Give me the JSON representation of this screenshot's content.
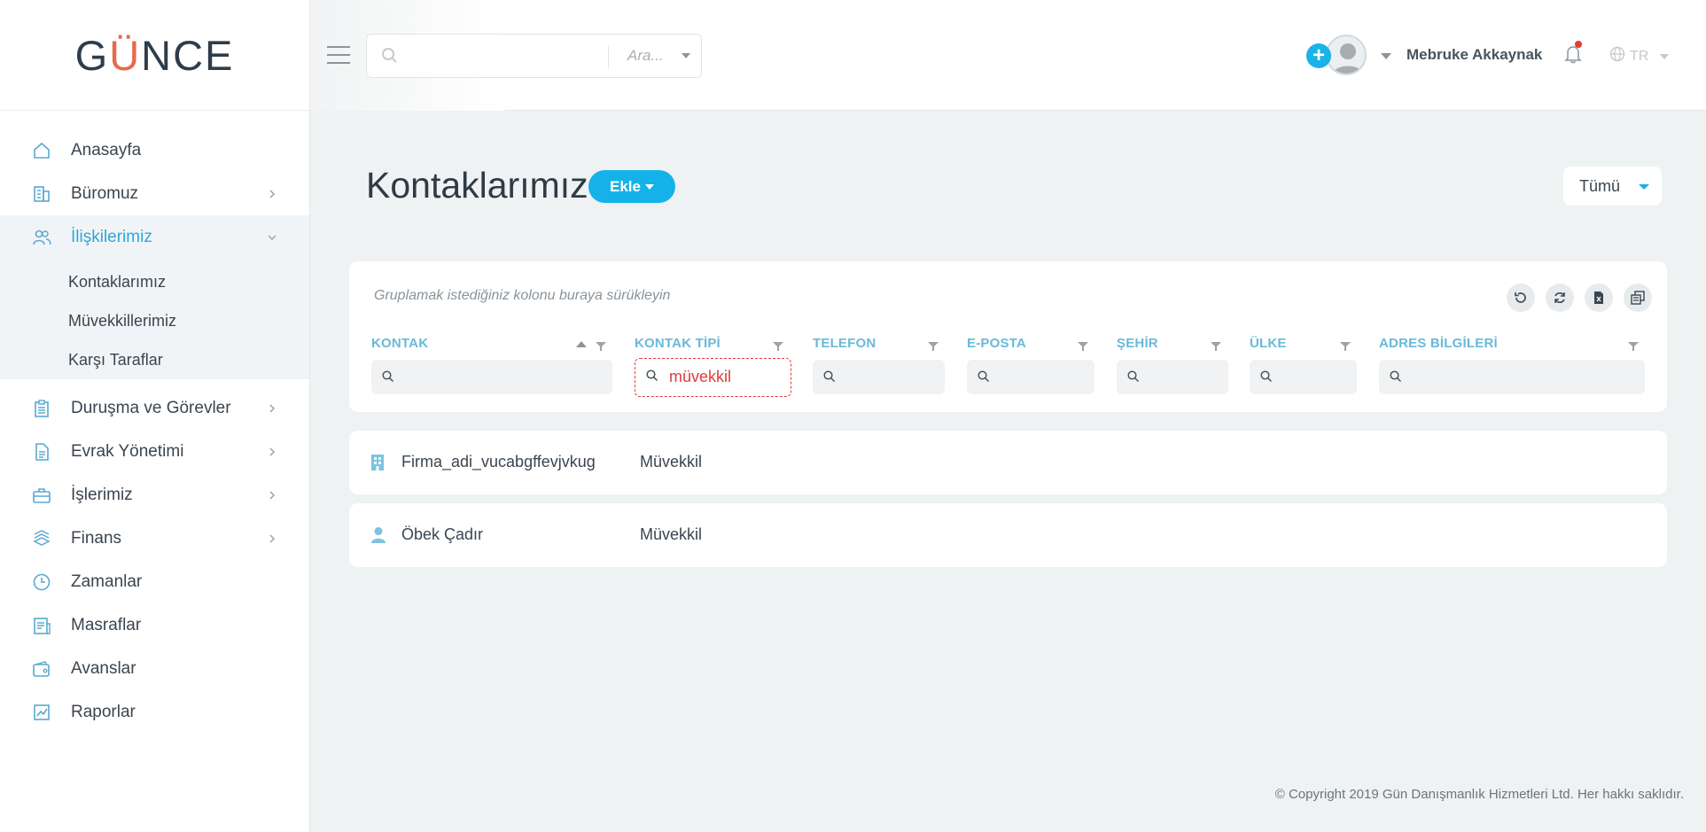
{
  "brand": {
    "logo_prefix": "G",
    "logo_o": "Ü",
    "logo_suffix": "NCE"
  },
  "sidebar": {
    "items": [
      {
        "label": "Anasayfa",
        "icon": "home-icon"
      },
      {
        "label": "Büromuz",
        "icon": "building-icon",
        "has_children": true
      },
      {
        "label": "İlişkilerimiz",
        "icon": "users-icon",
        "has_children": true,
        "expanded": true,
        "children": [
          "Kontaklarımız",
          "Müvekkillerimiz",
          "Karşı Taraflar"
        ]
      },
      {
        "label": "Duruşma ve Görevler",
        "icon": "clipboard-icon",
        "has_children": true
      },
      {
        "label": "Evrak Yönetimi",
        "icon": "document-icon",
        "has_children": true
      },
      {
        "label": "İşlerimiz",
        "icon": "briefcase-icon",
        "has_children": true
      },
      {
        "label": "Finans",
        "icon": "money-icon",
        "has_children": true
      },
      {
        "label": "Zamanlar",
        "icon": "clock-icon"
      },
      {
        "label": "Masraflar",
        "icon": "receipt-icon"
      },
      {
        "label": "Avanslar",
        "icon": "wallet-icon"
      },
      {
        "label": "Raporlar",
        "icon": "chart-icon"
      }
    ]
  },
  "header": {
    "search_scope": "Ara...",
    "user_name": "Mebruke Akkaynak",
    "language": "TR"
  },
  "page": {
    "title": "Kontaklarımız",
    "add_button": "Ekle",
    "filter_select": "Tümü"
  },
  "grid": {
    "group_hint": "Gruplamak istediğiniz kolonu buraya sürükleyin",
    "columns": [
      "KONTAK",
      "KONTAK TİPİ",
      "TELEFON",
      "E-POSTA",
      "ŞEHİR",
      "ÜLKE",
      "ADRES BİLGİLERİ"
    ],
    "type_filter_value": "müvekkil",
    "rows": [
      {
        "name": "Firma_adi_vucabgffevjvkug",
        "type": "Müvekkil",
        "icon": "building-icon"
      },
      {
        "name": "Öbek Çadır",
        "type": "Müvekkil",
        "icon": "person-icon"
      }
    ]
  },
  "footer": {
    "copyright": "© Copyright 2019 Gün Danışmanlık Hizmetleri Ltd. Her hakkı saklıdır."
  },
  "colors": {
    "accent": "#15b2ea",
    "active_nav": "#2fa7d8",
    "column_header": "#6ab9d9",
    "filter_highlight": "#e23b3b"
  }
}
